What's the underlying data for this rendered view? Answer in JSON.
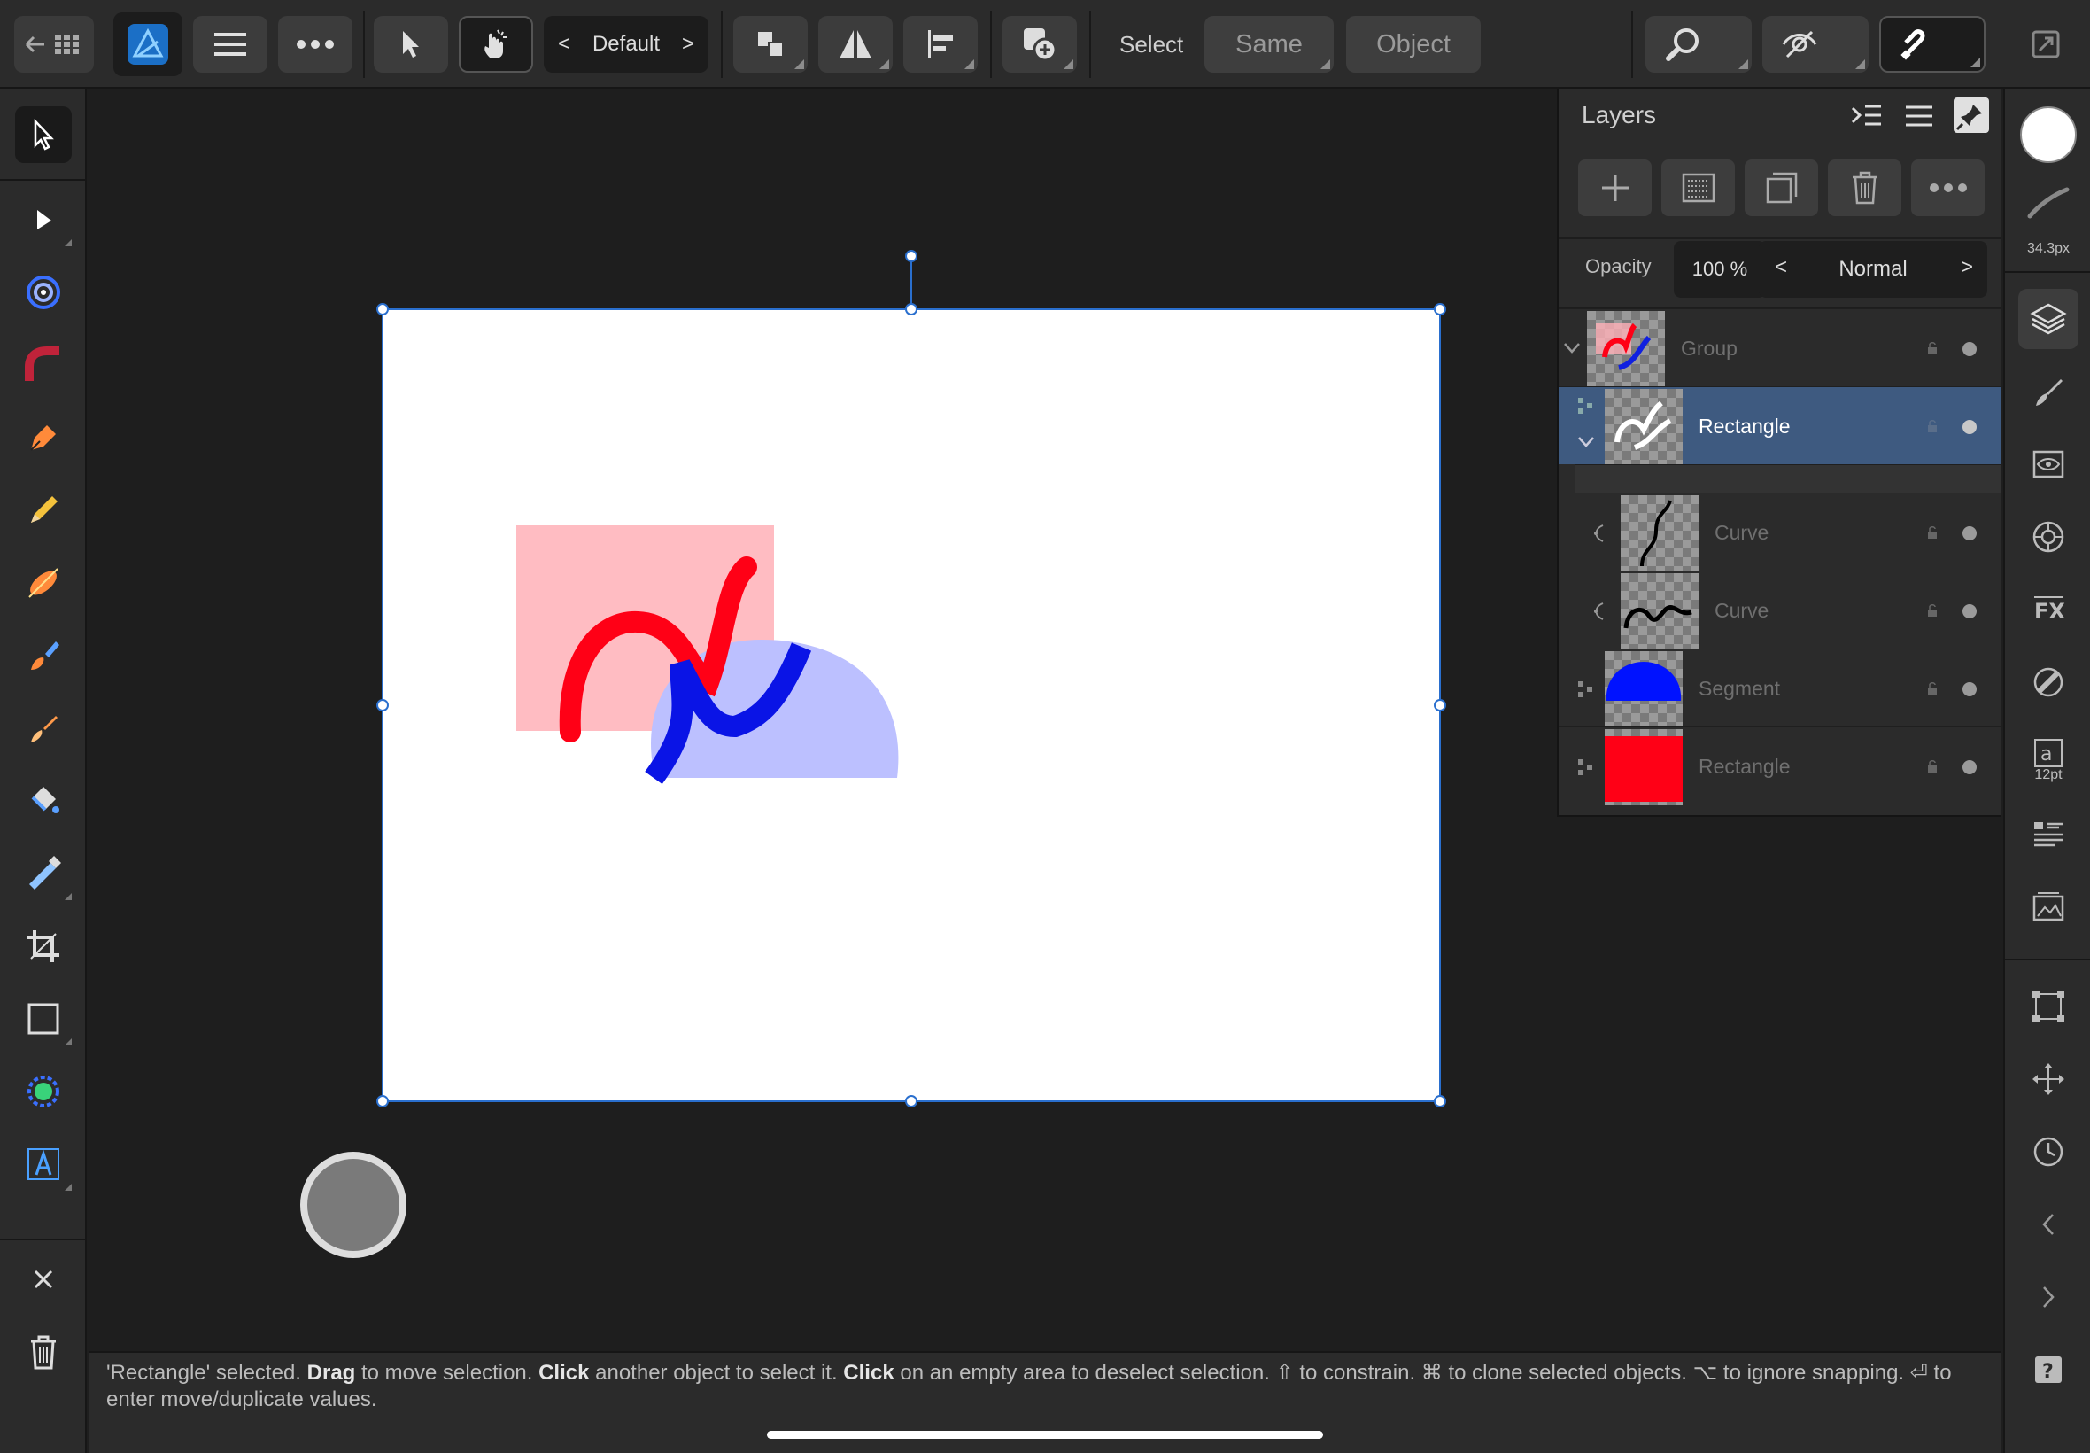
{
  "toolbar": {
    "preset": "Default",
    "select_label": "Select",
    "same_label": "Same",
    "object_label": "Object"
  },
  "layers_panel": {
    "title": "Layers",
    "opacity_label": "Opacity",
    "opacity_value": "100 %",
    "blend_mode": "Normal",
    "layers": [
      {
        "name": "Group"
      },
      {
        "name": "Rectangle"
      },
      {
        "name": "Curve"
      },
      {
        "name": "Curve"
      },
      {
        "name": "Segment"
      },
      {
        "name": "Rectangle"
      }
    ]
  },
  "studio": {
    "brush_size": "34.3px",
    "text_size": "12pt"
  },
  "status": {
    "p1": "'Rectangle' selected. ",
    "b1": "Drag",
    "p2": " to move selection. ",
    "b2": "Click",
    "p3": " another object to select it. ",
    "b3": "Click",
    "p4": " on an empty area to deselect selection. ⇧ to constrain. ⌘ to clone selected objects. ⌥ to ignore snapping. ⏎ to enter move/duplicate values."
  },
  "colors": {
    "accent": "#2a7fd4",
    "selected_row": "#3e5a80",
    "pink_rect": "#ffbcc2",
    "red_curve": "#ff0016",
    "lavender_segment": "#bcc0ff",
    "blue_curve": "#0a14e6"
  }
}
